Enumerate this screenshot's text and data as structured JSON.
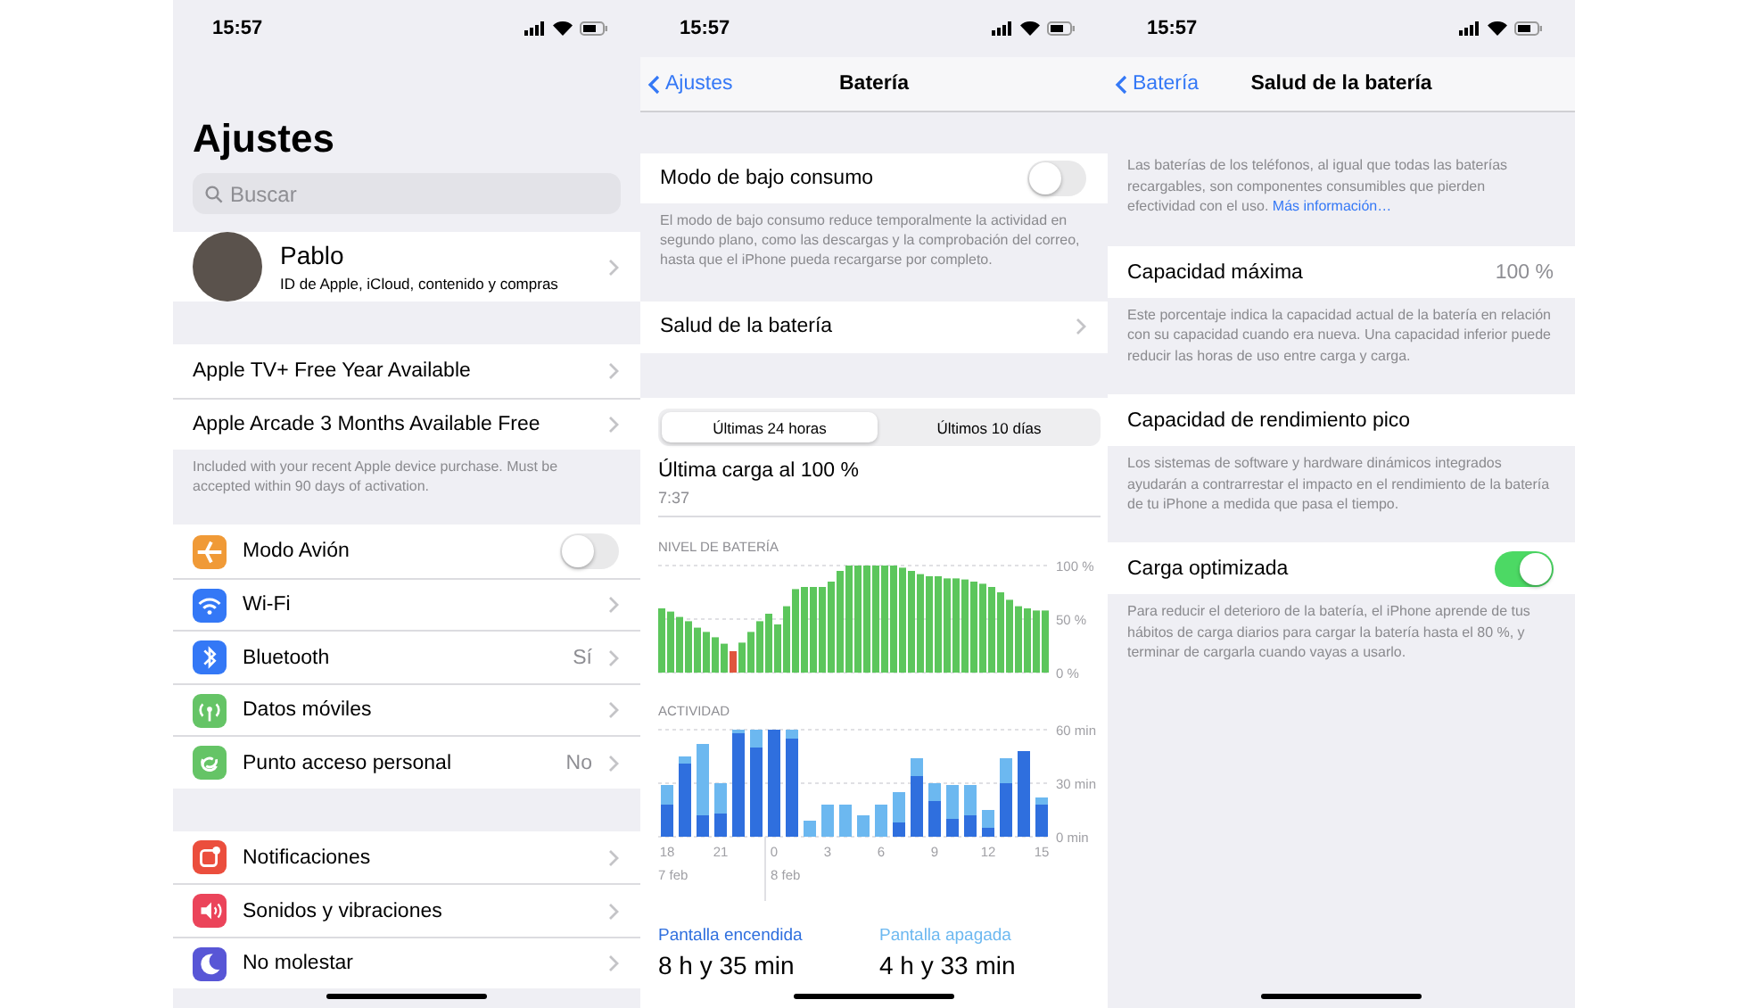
{
  "settings_screen": {
    "status_bar": {
      "time": "15:57"
    },
    "title": "Ajustes",
    "search": {
      "placeholder": "Buscar"
    },
    "profile": {
      "name": "Pablo",
      "subtitle": "ID de Apple, iCloud, contenido y compras"
    },
    "groups": [
      {
        "rows": [
          {
            "label": "Apple TV+ Free Year Available",
            "kind": "link"
          },
          {
            "label": "Apple Arcade 3 Months Available Free",
            "kind": "link"
          }
        ],
        "footer": "Included with your recent Apple device purchase. Must be accepted within 90 days of activation."
      },
      {
        "rows": [
          {
            "label": "Modo Avión",
            "kind": "toggle",
            "on": false,
            "color": "#f09a37"
          },
          {
            "label": "Wi-Fi",
            "kind": "link",
            "color": "#3478f6"
          },
          {
            "label": "Bluetooth",
            "kind": "link",
            "value": "Sí",
            "color": "#3478f6"
          },
          {
            "label": "Datos móviles",
            "kind": "link",
            "color": "#65c466"
          },
          {
            "label": "Punto acceso personal",
            "kind": "link",
            "value": "No",
            "color": "#65c466"
          }
        ]
      },
      {
        "rows": [
          {
            "label": "Notificaciones",
            "kind": "link",
            "color": "#eb4e3d"
          },
          {
            "label": "Sonidos y vibraciones",
            "kind": "link",
            "color": "#eb445a"
          },
          {
            "label": "No molestar",
            "kind": "link",
            "color": "#5856d6"
          }
        ]
      }
    ]
  },
  "battery_screen": {
    "status_bar": {
      "time": "15:57"
    },
    "nav": {
      "back": "Ajustes",
      "title": "Batería"
    },
    "low_power": {
      "label": "Modo de bajo consumo",
      "on": false
    },
    "low_power_footer": "El modo de bajo consumo reduce temporalmente la actividad en segundo plano, como las descargas y la comprobación del correo, hasta que el iPhone pueda recargarse por completo.",
    "health_row": "Salud de la batería",
    "segments": [
      {
        "label": "Últimas 24 horas",
        "selected": true
      },
      {
        "label": "Últimos 10 días",
        "selected": false
      }
    ],
    "last_charge": {
      "title": "Última carga al 100 %",
      "time": "7:37"
    },
    "battery_chart": {
      "chart_data": {
        "type": "bar",
        "title": "NIVEL DE BATERÍA",
        "ylim": [
          0,
          100
        ],
        "yticks": [
          {
            "value": 0,
            "label": "0 %"
          },
          {
            "value": 50,
            "label": "50 %"
          },
          {
            "value": 100,
            "label": "100 %"
          }
        ],
        "values": [
          60,
          57,
          52,
          48,
          42,
          38,
          33,
          27,
          20,
          28,
          38,
          48,
          55,
          45,
          62,
          78,
          80,
          80,
          80,
          85,
          95,
          100,
          100,
          100,
          100,
          100,
          100,
          98,
          95,
          92,
          90,
          90,
          88,
          88,
          87,
          85,
          83,
          80,
          75,
          68,
          62,
          60,
          58,
          58
        ]
      }
    },
    "activity_chart": {
      "chart_data": {
        "type": "bar",
        "title": "ACTIVIDAD",
        "stacked": true,
        "ylim": [
          0,
          60
        ],
        "yticks": [
          {
            "value": 0,
            "label": "0 min"
          },
          {
            "value": 30,
            "label": "30 min"
          },
          {
            "value": 60,
            "label": "60 min"
          }
        ],
        "categories": [
          "18",
          null,
          null,
          "21",
          null,
          null,
          "0",
          null,
          null,
          "3",
          null,
          null,
          "6",
          null,
          null,
          "9",
          null,
          null,
          "12",
          null,
          null,
          "15"
        ],
        "series": [
          {
            "name": "Pantalla encendida",
            "color": "#2f6fde",
            "values": [
              18,
              41,
              12,
              13,
              58,
              50,
              60,
              55,
              0,
              0,
              0,
              0,
              0,
              8,
              34,
              20,
              10,
              12,
              5,
              30,
              48,
              18
            ]
          },
          {
            "name": "Pantalla apagada",
            "color": "#6cb8f0",
            "values": [
              11,
              4,
              40,
              17,
              2,
              10,
              0,
              5,
              9,
              18,
              18,
              12,
              18,
              17,
              10,
              10,
              19,
              17,
              10,
              14,
              0,
              4
            ]
          }
        ]
      }
    },
    "date_labels": [
      "7 feb",
      "8 feb"
    ],
    "totals": [
      {
        "value": "8 h y 35 min"
      },
      {
        "value": "4 h y 33 min"
      }
    ]
  },
  "health_screen": {
    "status_bar": {
      "time": "15:57"
    },
    "nav": {
      "back": "Batería",
      "title": "Salud de la batería"
    },
    "intro": {
      "text": "Las baterías de los teléfonos, al igual que todas las baterías recargables, son componentes consumibles que pierden efectividad con el uso.",
      "link": "Más información…"
    },
    "sections": [
      {
        "label": "Capacidad máxima",
        "kind": "value",
        "value": "100 %",
        "footer": "Este porcentaje indica la capacidad actual de la batería en relación con su capacidad cuando era nueva. Una capacidad inferior puede reducir las horas de uso entre carga y carga."
      },
      {
        "label": "Capacidad de rendimiento pico",
        "kind": "plain",
        "footer": "Los sistemas de software y hardware dinámicos integrados ayudarán a contrarrestar el impacto en el rendimiento de la batería de tu iPhone a medida que pasa el tiempo."
      },
      {
        "label": "Carga optimizada",
        "kind": "toggle",
        "on": true,
        "footer": "Para reducir el deterioro de la batería, el iPhone aprende de tus hábitos de carga diarios para cargar la batería hasta el 80 %, y terminar de cargarla cuando vayas a usarlo."
      }
    ]
  }
}
